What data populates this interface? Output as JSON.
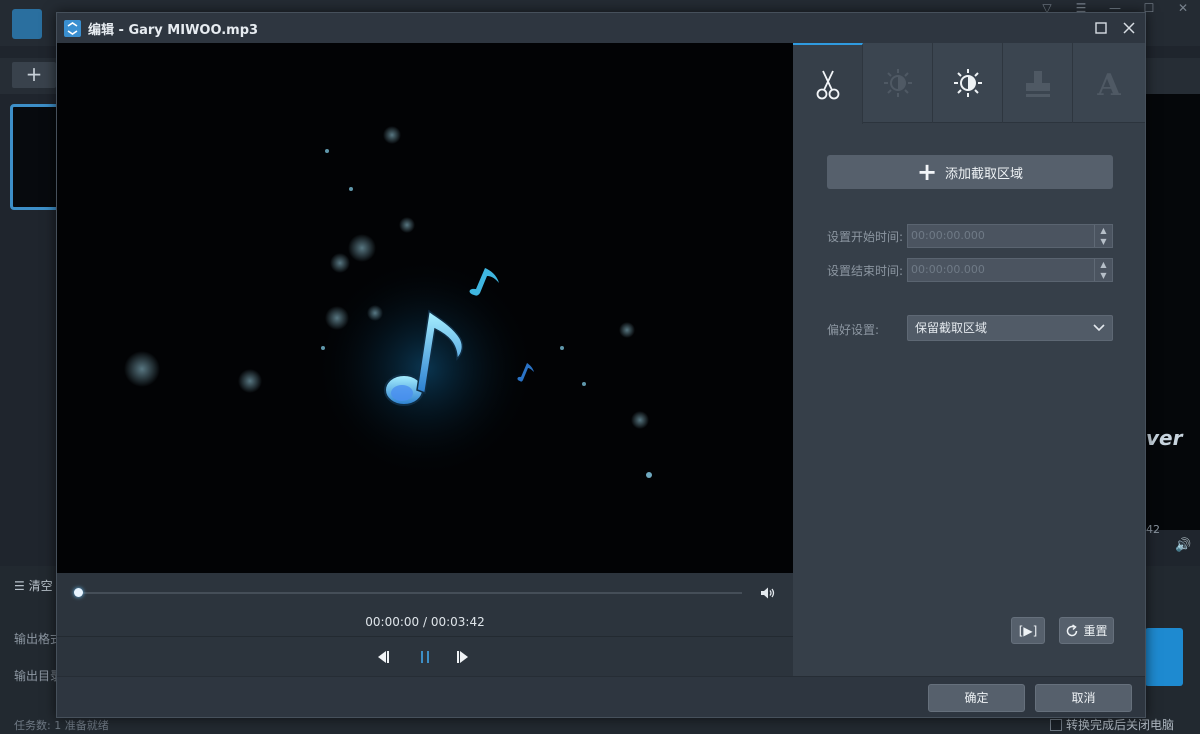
{
  "background_app": {
    "add_label": "+",
    "clear_label": "清空",
    "output_format_label": "输出格式",
    "output_dir_label": "输出目录",
    "status_text": "任务数: 1    准备就绪",
    "preview_watermark": "ver",
    "preview_time": "42",
    "shutdown_label": "转换完成后关闭电脑",
    "window_controls": [
      "▽",
      "☰",
      "—",
      "☐",
      "✕"
    ]
  },
  "dialog": {
    "title": "编辑 - Gary MIWOO.mp3",
    "player": {
      "current_time": "00:00:00",
      "total_time": "00:03:42",
      "time_display": "00:00:00 / 00:03:42",
      "progress": 0
    },
    "tabs": [
      {
        "icon": "scissors-icon",
        "active": true
      },
      {
        "icon": "brightness-low-icon",
        "active": false
      },
      {
        "icon": "brightness-high-icon",
        "active": false
      },
      {
        "icon": "stamp-icon",
        "active": false
      },
      {
        "icon": "text-icon",
        "active": false
      }
    ],
    "trim": {
      "add_region_label": "添加截取区域",
      "start_time_label": "设置开始时间:",
      "start_time_value": "00:00:00.000",
      "end_time_label": "设置结束时间:",
      "end_time_value": "00:00:00.000",
      "preference_label": "偏好设置:",
      "preference_value": "保留截取区域",
      "preview_clip_label": "[▶]",
      "reset_label": "重置"
    },
    "footer": {
      "ok_label": "确定",
      "cancel_label": "取消"
    },
    "colors": {
      "accent": "#2f9be0",
      "note": "#5cc8f0"
    }
  }
}
